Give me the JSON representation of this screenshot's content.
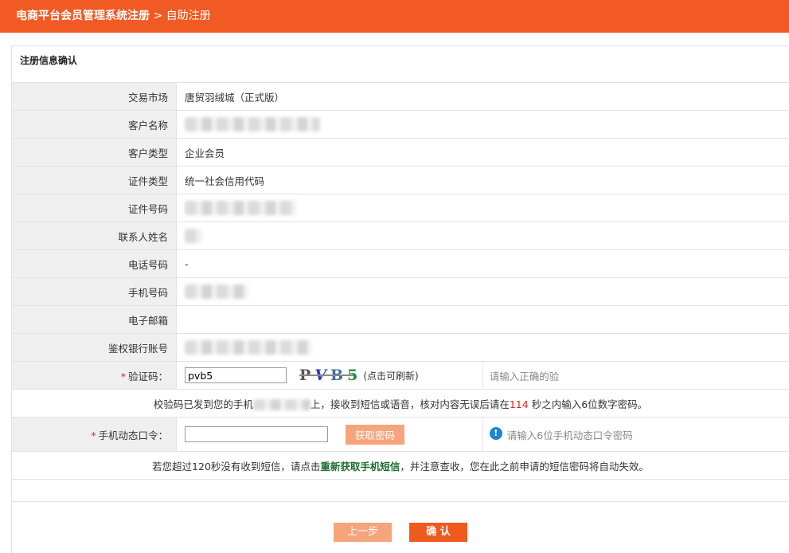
{
  "header": {
    "title": "电商平台会员管理系统注册",
    "separator": " > ",
    "current": "自助注册"
  },
  "panel": {
    "title": "注册信息确认"
  },
  "fields": [
    {
      "label": "交易市场",
      "value": "唐贸羽绒城（正式版）"
    },
    {
      "label": "客户名称",
      "value": ""
    },
    {
      "label": "客户类型",
      "value": "企业会员"
    },
    {
      "label": "证件类型",
      "value": "统一社会信用代码"
    },
    {
      "label": "证件号码",
      "value": ""
    },
    {
      "label": "联系人姓名",
      "value": ""
    },
    {
      "label": "电话号码",
      "value": "-"
    },
    {
      "label": "手机号码",
      "value": ""
    },
    {
      "label": "电子邮箱",
      "value": ""
    },
    {
      "label": "鉴权银行账号",
      "value": ""
    }
  ],
  "captcha": {
    "required_mark": "*",
    "label": "验证码：",
    "input_value": "pvb5",
    "image_text": [
      "P",
      "V",
      "B",
      "5"
    ],
    "refresh_text": "(点击可刷新)",
    "hint": "请输入正确的验"
  },
  "sms_notice": {
    "before": "校验码已发到您的手机",
    "after": "上，接收到短信或语音，核对内容无误后请在",
    "seconds": "114",
    "end": "秒之内输入6位数字密码。"
  },
  "dynamic_code": {
    "required_mark": "*",
    "label": "手机动态口令：",
    "input_value": "",
    "button": "获取密码",
    "hint_icon": "info-icon",
    "hint": "请输入6位手机动态口令密码"
  },
  "resend_notice": {
    "before": "若您超过120秒没有收到短信，请点击",
    "link": "重新获取手机短信",
    "after": "，并注意查收，您在此之前申请的短信密码将自动失效。"
  },
  "buttons": {
    "prev": "上一步",
    "confirm": "确  认"
  },
  "colors": {
    "header_bg": "#f15a22",
    "button_primary": "#ef5a1f",
    "button_light": "#f6a47c",
    "link_green": "#1a6d2e",
    "countdown_red": "#e3211c"
  }
}
